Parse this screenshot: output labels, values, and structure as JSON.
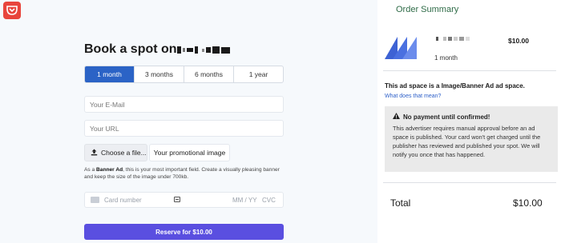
{
  "form": {
    "title": "Book a spot on",
    "plans": [
      "1 month",
      "3 months",
      "6 months",
      "1 year"
    ],
    "active_plan": "1 month",
    "email_placeholder": "Your E-Mail",
    "url_placeholder": "Your URL",
    "choose_file_label": "Choose a file...",
    "file_field_label": "Your promotional image",
    "hint_prefix": "As a ",
    "hint_bold": "Banner Ad",
    "hint_rest": ", this is your most important field. Create a visually pleasing banner and keep the size of the image under 700kb.",
    "card_number_placeholder": "Card number",
    "card_expiry_placeholder": "MM / YY",
    "card_cvc_placeholder": "CVC",
    "reserve_label": "Reserve for $10.00"
  },
  "summary": {
    "title": "Order Summary",
    "item_price": "$10.00",
    "item_duration": "1 month",
    "ad_space_text": "This ad space is a Image/Banner Ad ad space.",
    "what_link": "What does that mean?",
    "notice_title": "No payment until confirmed!",
    "notice_body": "This advertiser requires manual approval before an ad space is published. Your card won't get charged until the publisher has reviewed and published your spot. We will notify you once that has happened.",
    "total_label": "Total",
    "total_value": "$10.00"
  },
  "colors": {
    "accent_blue": "#2b63c6",
    "reserve_purple": "#5a4fe0",
    "logo_red": "#e8453c",
    "summary_title_green": "#2e6b47"
  },
  "icons": [
    "app-logo-icon",
    "upload-icon",
    "credit-card-icon",
    "card-scan-icon",
    "warning-icon",
    "product-logo-icon"
  ]
}
